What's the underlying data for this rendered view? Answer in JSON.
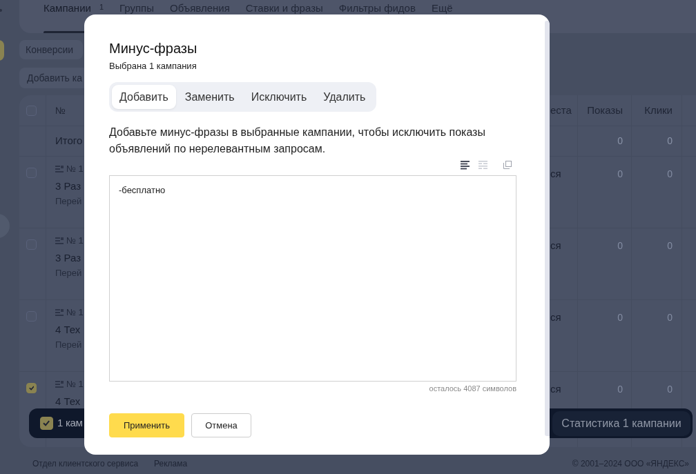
{
  "top_tabs": [
    {
      "label": "Кампании",
      "count": "1",
      "selected": true
    },
    {
      "label": "Группы",
      "selected": false
    },
    {
      "label": "Объявления",
      "selected": false
    },
    {
      "label": "Ставки и фразы",
      "selected": false
    },
    {
      "label": "Фильтры фидов",
      "selected": false
    },
    {
      "label": "Ещё",
      "selected": false
    }
  ],
  "toolbar": {
    "conversions_button": "Конверсии",
    "add_button": "Добавить ка"
  },
  "table": {
    "select_all_checked": false,
    "number_column": "№",
    "columns": [
      "еста",
      "Показы",
      "Клики"
    ],
    "total_row": {
      "label": "Итого",
      "cells": [
        "0",
        "0"
      ]
    },
    "rows": [
      {
        "checked": false,
        "number": "№ 1",
        "name": "3 Раз",
        "link": "Перей",
        "cells": [
          "ся",
          "0",
          "0"
        ]
      },
      {
        "checked": false,
        "number": "№ 1",
        "name": "3 Раз",
        "link": "Перей",
        "cells": [
          "ся",
          "0",
          "0"
        ]
      },
      {
        "checked": false,
        "number": "№ 1",
        "name": "4 Тех",
        "link": "Перей",
        "cells": [
          "ся",
          "0",
          "0"
        ]
      },
      {
        "checked": true,
        "number": "№ 1",
        "name": "4 Тех",
        "cells": [
          "ся",
          "0",
          "0"
        ]
      }
    ]
  },
  "selection_bar": {
    "checked": true,
    "label": "1 кам",
    "stats_button": "Статистика 1 кампании"
  },
  "footer": {
    "links": [
      "Отдел клиентского сервиса",
      "Реклама"
    ],
    "copyright": "© 2001–2024 ООО «ЯНДЕКС»"
  },
  "dialog": {
    "title": "Минус-фразы",
    "subtitle": "Выбрана 1 кампания",
    "modes": [
      {
        "label": "Добавить",
        "selected": true
      },
      {
        "label": "Заменить",
        "selected": false
      },
      {
        "label": "Исключить",
        "selected": false
      },
      {
        "label": "Удалить",
        "selected": false
      }
    ],
    "description": "Добавьте минус-фразы в выбранные кампании, чтобы исключить показы объявлений по нерелевантным запросам.",
    "view_buttons": [
      {
        "selected": true
      },
      {
        "selected": false
      }
    ],
    "phrases": "-бесплатно",
    "counter": "осталось 4087 символов",
    "buttons": [
      {
        "label": "Применить",
        "kind": "primary"
      },
      {
        "label": "Отмена",
        "kind": "secondary"
      }
    ]
  }
}
